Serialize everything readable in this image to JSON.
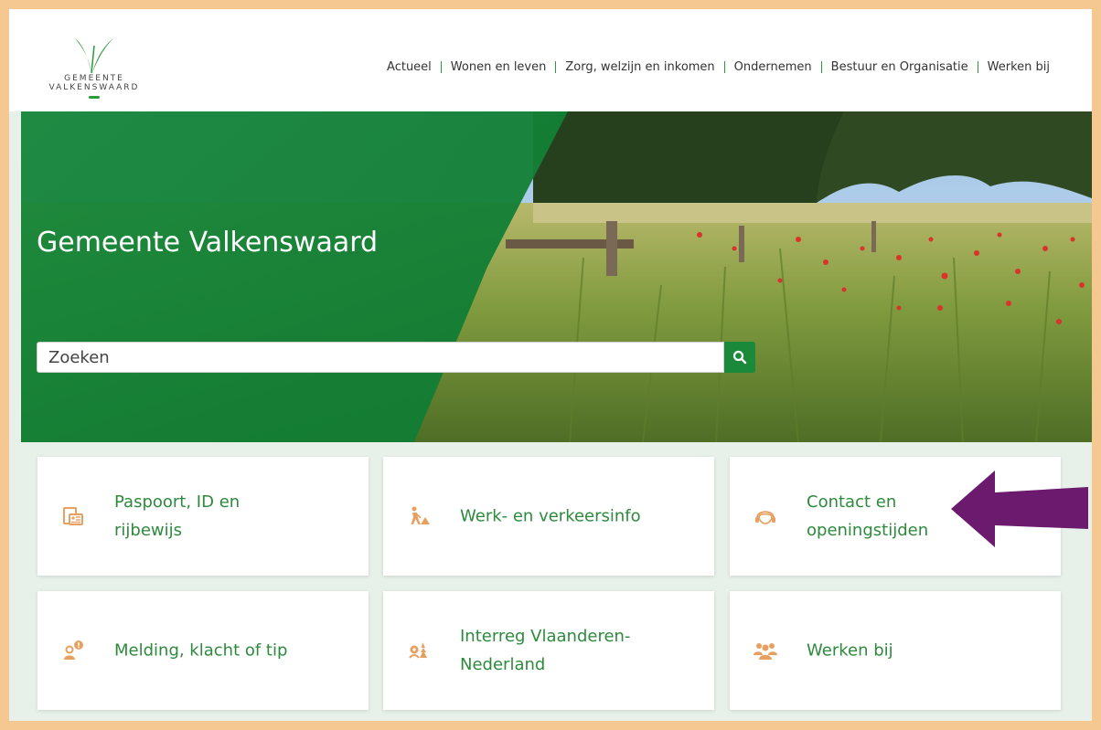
{
  "header": {
    "logo": {
      "line1": "GEMEENTE",
      "line2": "VALKENSWAARD",
      "icon": "valkenswaard-v-logo-icon"
    },
    "nav": [
      {
        "label": "Actueel"
      },
      {
        "label": "Wonen en leven"
      },
      {
        "label": "Zorg, welzijn en inkomen"
      },
      {
        "label": "Ondernemen"
      },
      {
        "label": "Bestuur en Organisatie"
      },
      {
        "label": "Werken bij"
      }
    ]
  },
  "hero": {
    "title": "Gemeente Valkenswaard",
    "search": {
      "placeholder": "Zoeken",
      "icon": "search-icon"
    }
  },
  "tiles": [
    {
      "label_line1": "Paspoort, ID en",
      "label_line2": "rijbewijs",
      "icon": "passport-id-icon"
    },
    {
      "label_line1": "Werk- en verkeersinfo",
      "label_line2": "",
      "icon": "roadwork-icon"
    },
    {
      "label_line1": "Contact en",
      "label_line2": "openingstijden",
      "icon": "headset-contact-icon"
    },
    {
      "label_line1": "Melding, klacht of tip",
      "label_line2": "",
      "icon": "report-notification-icon"
    },
    {
      "label_line1": "Interreg Vlaanderen-",
      "label_line2": "Nederland",
      "icon": "interreg-nature-icon"
    },
    {
      "label_line1": "Werken bij",
      "label_line2": "",
      "icon": "people-group-icon"
    }
  ],
  "annotation": {
    "icon": "purple-arrow-icon"
  },
  "colors": {
    "brand_green": "#1a8a3a",
    "tile_text": "#2d8a3c",
    "icon_orange": "#e8a060",
    "frame": "#f5c892",
    "arrow": "#6b1a6e"
  }
}
